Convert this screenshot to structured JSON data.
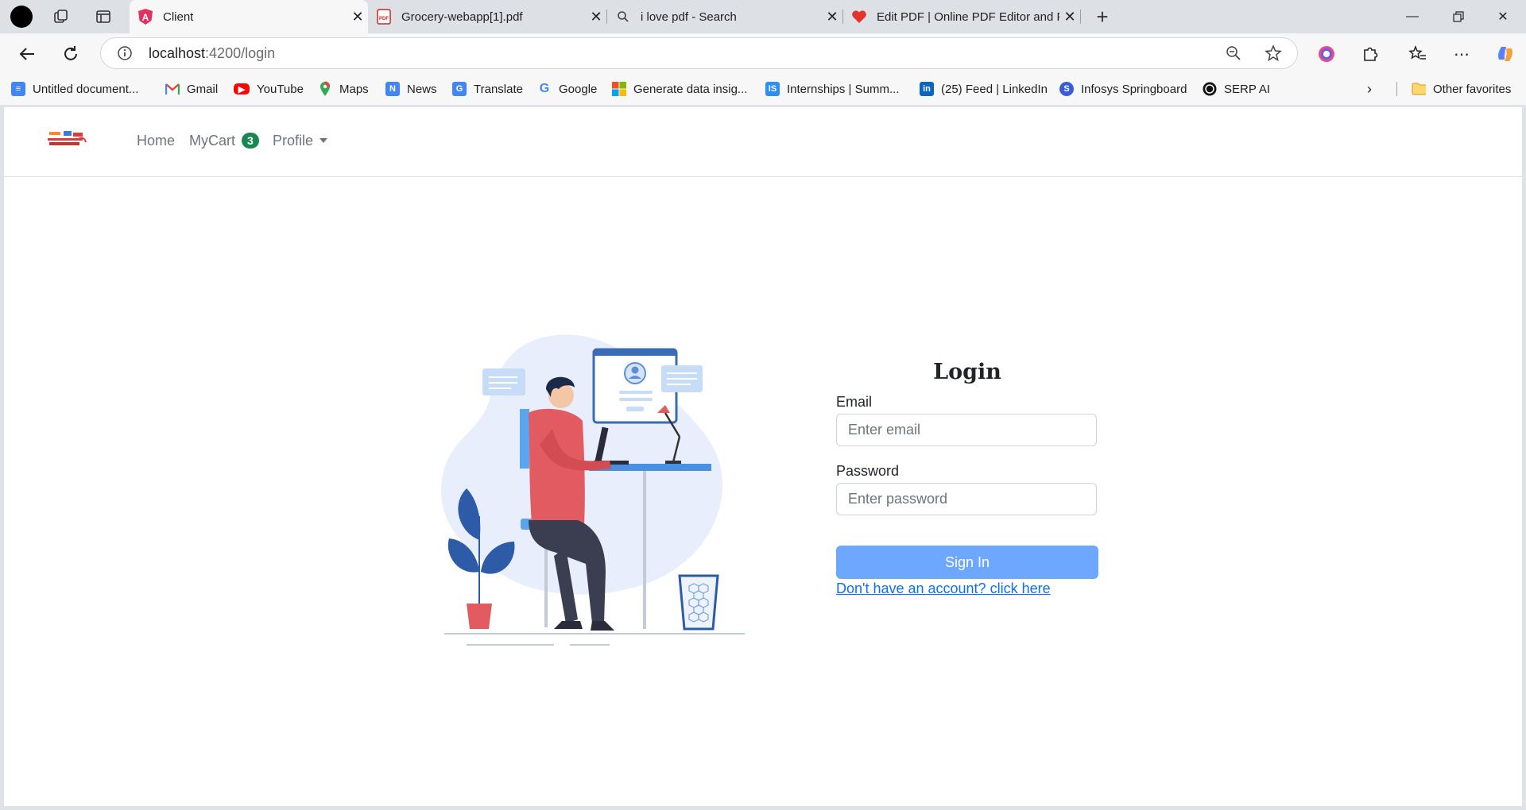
{
  "browser": {
    "tabs": [
      {
        "title": "Client",
        "icon": "angular-icon",
        "active": true
      },
      {
        "title": "Grocery-webapp[1].pdf",
        "icon": "pdf-icon",
        "active": false
      },
      {
        "title": "i love pdf - Search",
        "icon": "search-icon",
        "active": false
      },
      {
        "title": "Edit PDF | Online PDF Editor and F",
        "icon": "heart-icon",
        "active": false
      }
    ],
    "address": {
      "host": "localhost",
      "path": ":4200/login"
    },
    "bookmarks": [
      {
        "label": "Untitled document...",
        "icon": "docs-icon",
        "color": "#4285f4"
      },
      {
        "label": "Gmail",
        "icon": "gmail-icon",
        "color": "#ea4335"
      },
      {
        "label": "YouTube",
        "icon": "youtube-icon",
        "color": "#ff0000"
      },
      {
        "label": "Maps",
        "icon": "maps-icon",
        "color": "#34a853"
      },
      {
        "label": "News",
        "icon": "news-icon",
        "color": "#4285f4"
      },
      {
        "label": "Translate",
        "icon": "translate-icon",
        "color": "#4285f4"
      },
      {
        "label": "Google",
        "icon": "google-icon",
        "color": "#4285f4"
      },
      {
        "label": "Generate data insig...",
        "icon": "microsoft-icon",
        "color": "#f25022"
      },
      {
        "label": "Internships | Summ...",
        "icon": "is-icon",
        "color": "#2c8ef8"
      },
      {
        "label": "(25) Feed | LinkedIn",
        "icon": "linkedin-icon",
        "color": "#0a66c2"
      },
      {
        "label": "Infosys Springboard",
        "icon": "springboard-icon",
        "color": "#3b5bdb"
      },
      {
        "label": "SERP AI",
        "icon": "serp-icon",
        "color": "#111111"
      }
    ],
    "other_favorites": "Other favorites"
  },
  "app": {
    "nav": {
      "home": "Home",
      "cart": "MyCart",
      "cart_count": "3",
      "profile": "Profile"
    },
    "login": {
      "title": "Login",
      "email_label": "Email",
      "email_placeholder": "Enter email",
      "password_label": "Password",
      "password_placeholder": "Enter password",
      "submit": "Sign In",
      "signup_link": "Don't have an account? click here"
    }
  },
  "colors": {
    "primary_light": "#6ea8fe",
    "badge": "#198754",
    "link": "#0d6efd",
    "illustration_accent": "#e25b60"
  }
}
